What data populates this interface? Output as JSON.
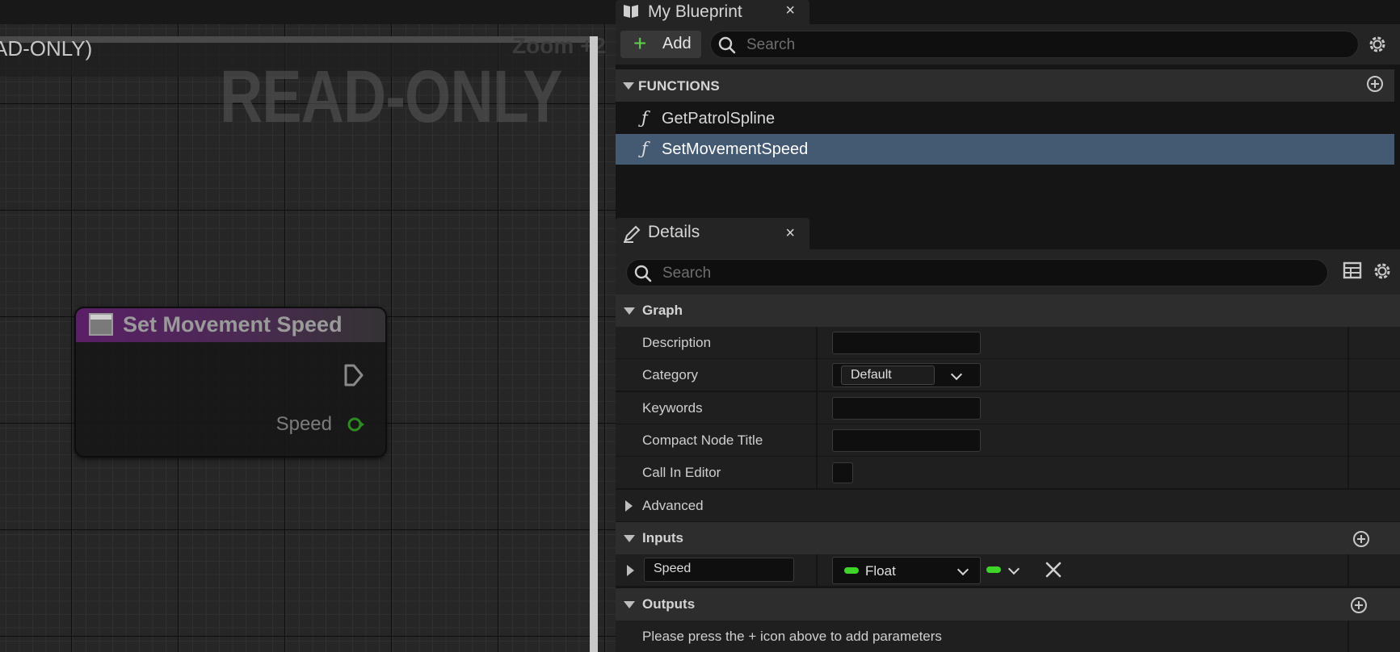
{
  "graph": {
    "title": "AD-ONLY)",
    "zoom": "Zoom +2",
    "watermark": "READ-ONLY",
    "node": {
      "title": "Set Movement Speed",
      "output_pin": "Speed"
    }
  },
  "my_blueprint": {
    "tab_title": "My Blueprint",
    "close": "×",
    "add_label": "Add",
    "search_placeholder": "Search",
    "functions_header": "FUNCTIONS",
    "functions": [
      {
        "label": "GetPatrolSpline",
        "selected": false
      },
      {
        "label": "SetMovementSpeed",
        "selected": true
      }
    ]
  },
  "details": {
    "tab_title": "Details",
    "close": "×",
    "search_placeholder": "Search",
    "graph_section": "Graph",
    "rows": {
      "description": "Description",
      "category": "Category",
      "category_value": "Default",
      "keywords": "Keywords",
      "compact_node_title": "Compact Node Title",
      "call_in_editor": "Call In Editor"
    },
    "advanced_section": "Advanced",
    "inputs_section": "Inputs",
    "input_param": {
      "name": "Speed",
      "type": "Float"
    },
    "outputs_section": "Outputs",
    "outputs_hint": "Please press the + icon above to add parameters"
  },
  "colors": {
    "accent_selected": "#445a73",
    "float_pin": "#3fd42a",
    "node_header": "#5a1f66",
    "add_plus": "#5fd14a"
  }
}
